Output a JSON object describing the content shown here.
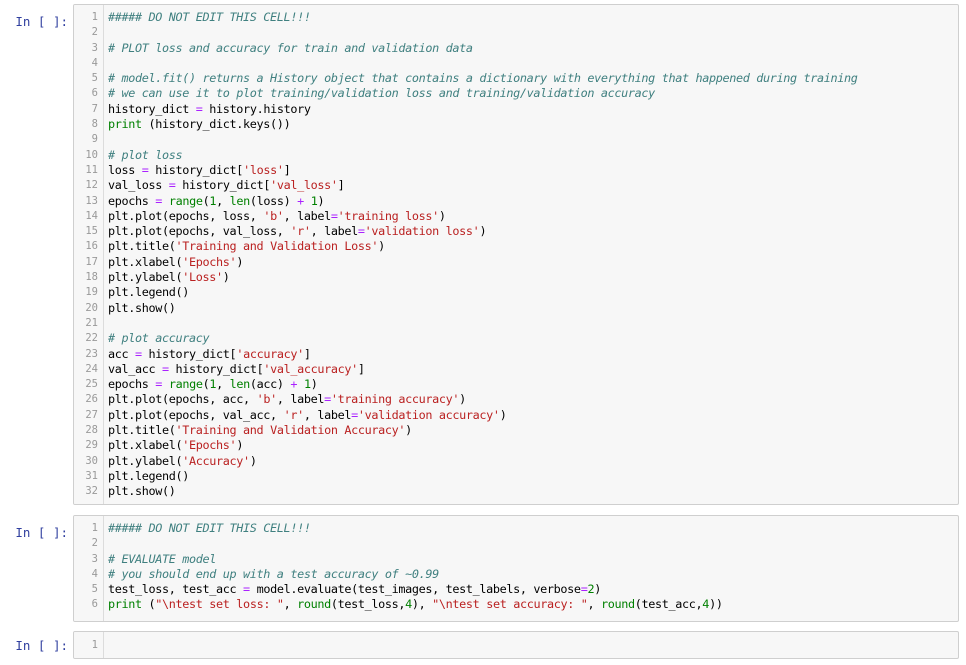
{
  "cells": [
    {
      "prompt": "In [ ]:",
      "lines": [
        [
          [
            "comment",
            "##### DO NOT EDIT THIS CELL!!!"
          ]
        ],
        [],
        [
          [
            "comment",
            "# PLOT loss and accuracy for train and validation data"
          ]
        ],
        [],
        [
          [
            "comment",
            "# model.fit() returns a History object that contains a dictionary with everything that happened during training"
          ]
        ],
        [
          [
            "comment",
            "# we can use it to plot training/validation loss and training/validation accuracy"
          ]
        ],
        [
          [
            "plain",
            "history_dict "
          ],
          [
            "op",
            "="
          ],
          [
            "plain",
            " history.history"
          ]
        ],
        [
          [
            "builtin",
            "print"
          ],
          [
            "plain",
            " (history_dict.keys())"
          ]
        ],
        [],
        [
          [
            "comment",
            "# plot loss"
          ]
        ],
        [
          [
            "plain",
            "loss "
          ],
          [
            "op",
            "="
          ],
          [
            "plain",
            " history_dict["
          ],
          [
            "string",
            "'loss'"
          ],
          [
            "plain",
            "]"
          ]
        ],
        [
          [
            "plain",
            "val_loss "
          ],
          [
            "op",
            "="
          ],
          [
            "plain",
            " history_dict["
          ],
          [
            "string",
            "'val_loss'"
          ],
          [
            "plain",
            "]"
          ]
        ],
        [
          [
            "plain",
            "epochs "
          ],
          [
            "op",
            "="
          ],
          [
            "plain",
            " "
          ],
          [
            "builtin",
            "range"
          ],
          [
            "plain",
            "("
          ],
          [
            "num",
            "1"
          ],
          [
            "plain",
            ", "
          ],
          [
            "builtin",
            "len"
          ],
          [
            "plain",
            "(loss) "
          ],
          [
            "op",
            "+"
          ],
          [
            "plain",
            " "
          ],
          [
            "num",
            "1"
          ],
          [
            "plain",
            ")"
          ]
        ],
        [
          [
            "plain",
            "plt.plot(epochs, loss, "
          ],
          [
            "string",
            "'b'"
          ],
          [
            "plain",
            ", label"
          ],
          [
            "op",
            "="
          ],
          [
            "string",
            "'training loss'"
          ],
          [
            "plain",
            ")"
          ]
        ],
        [
          [
            "plain",
            "plt.plot(epochs, val_loss, "
          ],
          [
            "string",
            "'r'"
          ],
          [
            "plain",
            ", label"
          ],
          [
            "op",
            "="
          ],
          [
            "string",
            "'validation loss'"
          ],
          [
            "plain",
            ")"
          ]
        ],
        [
          [
            "plain",
            "plt.title("
          ],
          [
            "string",
            "'Training and Validation Loss'"
          ],
          [
            "plain",
            ")"
          ]
        ],
        [
          [
            "plain",
            "plt.xlabel("
          ],
          [
            "string",
            "'Epochs'"
          ],
          [
            "plain",
            ")"
          ]
        ],
        [
          [
            "plain",
            "plt.ylabel("
          ],
          [
            "string",
            "'Loss'"
          ],
          [
            "plain",
            ")"
          ]
        ],
        [
          [
            "plain",
            "plt.legend()"
          ]
        ],
        [
          [
            "plain",
            "plt.show()"
          ]
        ],
        [],
        [
          [
            "comment",
            "# plot accuracy"
          ]
        ],
        [
          [
            "plain",
            "acc "
          ],
          [
            "op",
            "="
          ],
          [
            "plain",
            " history_dict["
          ],
          [
            "string",
            "'accuracy'"
          ],
          [
            "plain",
            "]"
          ]
        ],
        [
          [
            "plain",
            "val_acc "
          ],
          [
            "op",
            "="
          ],
          [
            "plain",
            " history_dict["
          ],
          [
            "string",
            "'val_accuracy'"
          ],
          [
            "plain",
            "]"
          ]
        ],
        [
          [
            "plain",
            "epochs "
          ],
          [
            "op",
            "="
          ],
          [
            "plain",
            " "
          ],
          [
            "builtin",
            "range"
          ],
          [
            "plain",
            "("
          ],
          [
            "num",
            "1"
          ],
          [
            "plain",
            ", "
          ],
          [
            "builtin",
            "len"
          ],
          [
            "plain",
            "(acc) "
          ],
          [
            "op",
            "+"
          ],
          [
            "plain",
            " "
          ],
          [
            "num",
            "1"
          ],
          [
            "plain",
            ")"
          ]
        ],
        [
          [
            "plain",
            "plt.plot(epochs, acc, "
          ],
          [
            "string",
            "'b'"
          ],
          [
            "plain",
            ", label"
          ],
          [
            "op",
            "="
          ],
          [
            "string",
            "'training accuracy'"
          ],
          [
            "plain",
            ")"
          ]
        ],
        [
          [
            "plain",
            "plt.plot(epochs, val_acc, "
          ],
          [
            "string",
            "'r'"
          ],
          [
            "plain",
            ", label"
          ],
          [
            "op",
            "="
          ],
          [
            "string",
            "'validation accuracy'"
          ],
          [
            "plain",
            ")"
          ]
        ],
        [
          [
            "plain",
            "plt.title("
          ],
          [
            "string",
            "'Training and Validation Accuracy'"
          ],
          [
            "plain",
            ")"
          ]
        ],
        [
          [
            "plain",
            "plt.xlabel("
          ],
          [
            "string",
            "'Epochs'"
          ],
          [
            "plain",
            ")"
          ]
        ],
        [
          [
            "plain",
            "plt.ylabel("
          ],
          [
            "string",
            "'Accuracy'"
          ],
          [
            "plain",
            ")"
          ]
        ],
        [
          [
            "plain",
            "plt.legend()"
          ]
        ],
        [
          [
            "plain",
            "plt.show()"
          ]
        ]
      ]
    },
    {
      "prompt": "In [ ]:",
      "lines": [
        [
          [
            "comment",
            "##### DO NOT EDIT THIS CELL!!!"
          ]
        ],
        [],
        [
          [
            "comment",
            "# EVALUATE model"
          ]
        ],
        [
          [
            "comment",
            "# you should end up with a test accuracy of ~0.99"
          ]
        ],
        [
          [
            "plain",
            "test_loss, test_acc "
          ],
          [
            "op",
            "="
          ],
          [
            "plain",
            " model.evaluate(test_images, test_labels, verbose"
          ],
          [
            "op",
            "="
          ],
          [
            "num",
            "2"
          ],
          [
            "plain",
            ")"
          ]
        ],
        [
          [
            "builtin",
            "print"
          ],
          [
            "plain",
            " ("
          ],
          [
            "string",
            "\"\\ntest set loss: \""
          ],
          [
            "plain",
            ", "
          ],
          [
            "builtin",
            "round"
          ],
          [
            "plain",
            "(test_loss,"
          ],
          [
            "num",
            "4"
          ],
          [
            "plain",
            "), "
          ],
          [
            "string",
            "\"\\ntest set accuracy: \""
          ],
          [
            "plain",
            ", "
          ],
          [
            "builtin",
            "round"
          ],
          [
            "plain",
            "(test_acc,"
          ],
          [
            "num",
            "4"
          ],
          [
            "plain",
            "))"
          ]
        ]
      ]
    },
    {
      "prompt": "In [ ]:",
      "lines": [
        []
      ]
    }
  ]
}
